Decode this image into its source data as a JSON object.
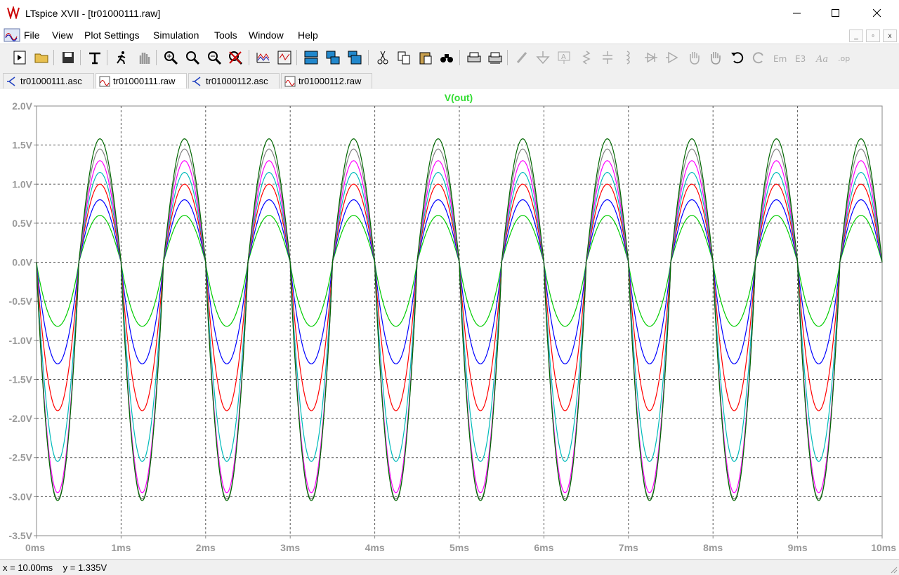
{
  "window": {
    "title": "LTspice XVII - [tr01000111.raw]"
  },
  "menu": [
    "File",
    "View",
    "Plot Settings",
    "Simulation",
    "Tools",
    "Window",
    "Help"
  ],
  "mdi_buttons": [
    "_",
    "▫",
    "x"
  ],
  "toolbar": {
    "icons": [
      "new-schematic-icon",
      "open-icon",
      "save-icon",
      "control-panel-icon",
      "run-icon",
      "halt-icon",
      "zoom-in-icon",
      "zoom-pan-icon",
      "zoom-out-icon",
      "zoom-cancel-icon",
      "autorange-icon",
      "zoom-full-icon",
      "tile-horizontal-icon",
      "cascade-icon",
      "tile-vertical-icon",
      "cut-icon",
      "copy-icon",
      "paste-icon",
      "find-icon",
      "print-icon",
      "print-setup-icon",
      "wire-icon",
      "ground-icon",
      "label-icon",
      "resistor-icon",
      "capacitor-icon",
      "inductor-icon",
      "diode-icon",
      "component-icon",
      "move-icon",
      "drag-icon",
      "undo-icon",
      "redo-icon",
      "rotate-icon",
      "mirror-icon",
      "text-icon",
      "spice-directive-icon"
    ]
  },
  "tabs": [
    {
      "label": "tr01000111.asc",
      "icon": "schematic-icon",
      "active": false
    },
    {
      "label": "tr01000111.raw",
      "icon": "waveform-icon",
      "active": true
    },
    {
      "label": "tr01000112.asc",
      "icon": "schematic-icon",
      "active": false
    },
    {
      "label": "tr01000112.raw",
      "icon": "waveform-icon",
      "active": false
    }
  ],
  "status": {
    "text": "x = 10.00ms    y = 1.335V"
  },
  "chart_data": {
    "type": "line",
    "title": "V(out)",
    "title_color": "#33dd33",
    "xlabel": "",
    "ylabel": "",
    "xlim": [
      0,
      10
    ],
    "ylim": [
      -3.5,
      2.0
    ],
    "x_unit": "ms",
    "frequency_khz": 1,
    "grid": true,
    "x_ticks": [
      "0ms",
      "1ms",
      "2ms",
      "3ms",
      "4ms",
      "5ms",
      "6ms",
      "7ms",
      "8ms",
      "9ms",
      "10ms"
    ],
    "y_ticks": [
      "2.0V",
      "1.5V",
      "1.0V",
      "0.5V",
      "0.0V",
      "-0.5V",
      "-1.0V",
      "-1.5V",
      "-2.0V",
      "-2.5V",
      "-3.0V",
      "-3.5V"
    ],
    "series": [
      {
        "color": "#00cc00",
        "peak": 0.6,
        "trough": -0.82
      },
      {
        "color": "#0000ff",
        "peak": 0.8,
        "trough": -1.3
      },
      {
        "color": "#ff0000",
        "peak": 1.0,
        "trough": -1.9
      },
      {
        "color": "#00bbbb",
        "peak": 1.15,
        "trough": -2.55
      },
      {
        "color": "#ff00ff",
        "peak": 1.3,
        "trough": -2.95
      },
      {
        "color": "#808080",
        "peak": 1.45,
        "trough": -3.03
      },
      {
        "color": "#006600",
        "peak": 1.58,
        "trough": -3.05
      }
    ]
  }
}
